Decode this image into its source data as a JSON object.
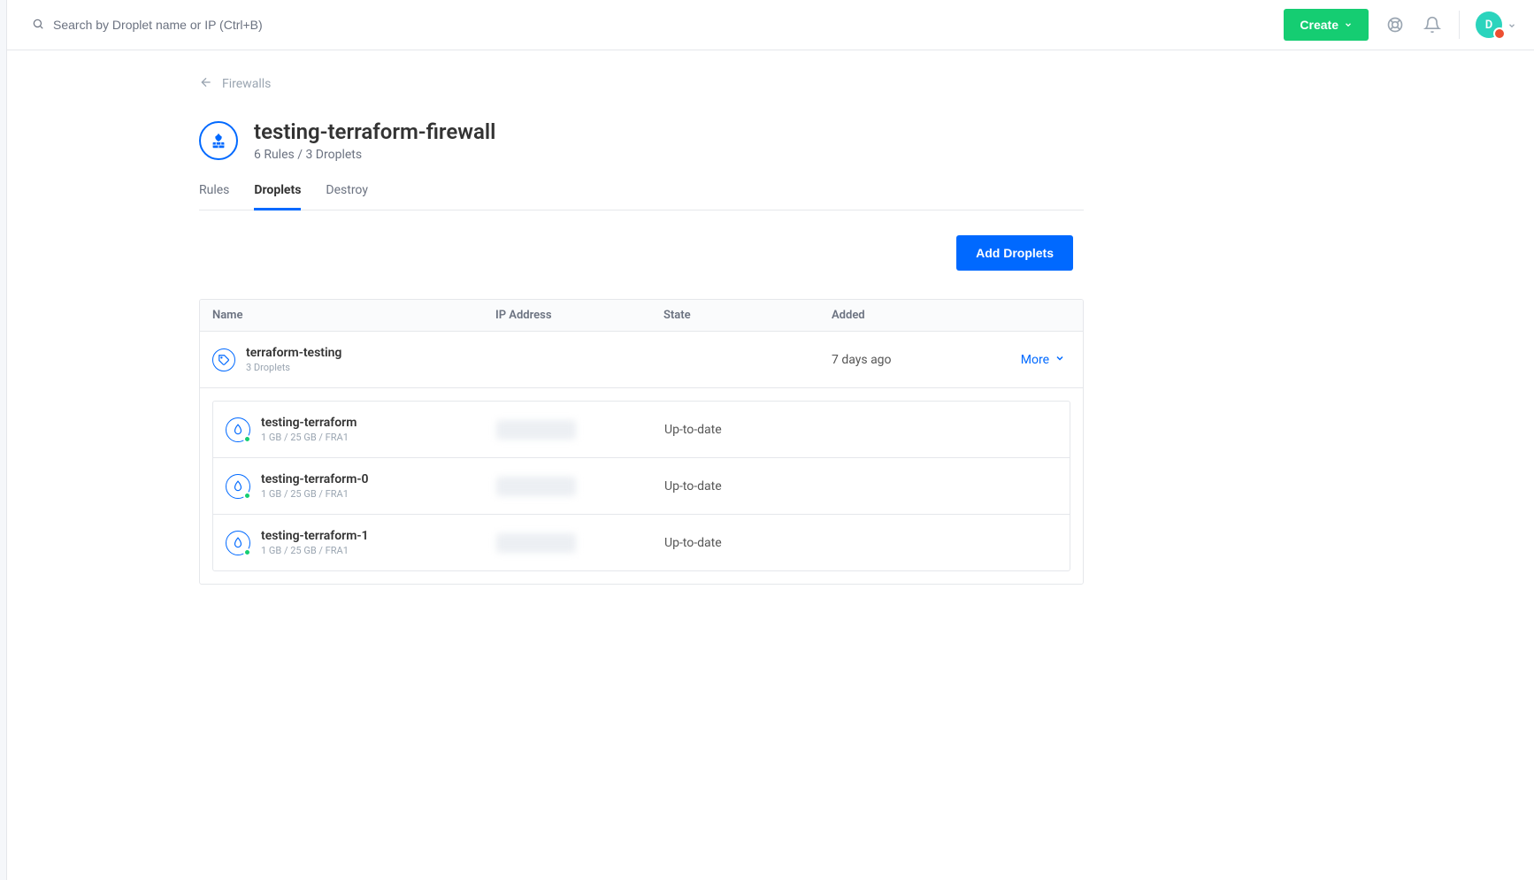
{
  "topbar": {
    "search_placeholder": "Search by Droplet name or IP (Ctrl+B)",
    "create_label": "Create",
    "avatar_initial": "D"
  },
  "breadcrumb": {
    "back_label": "Firewalls"
  },
  "page": {
    "title": "testing-terraform-firewall",
    "subtitle": "6 Rules / 3 Droplets"
  },
  "tabs": [
    {
      "label": "Rules",
      "active": false
    },
    {
      "label": "Droplets",
      "active": true
    },
    {
      "label": "Destroy",
      "active": false
    }
  ],
  "actions": {
    "add_droplets_label": "Add Droplets"
  },
  "table": {
    "columns": {
      "name": "Name",
      "ip": "IP Address",
      "state": "State",
      "added": "Added"
    },
    "group": {
      "name": "terraform-testing",
      "sub": "3 Droplets",
      "added": "7 days ago",
      "more_label": "More"
    },
    "droplets": [
      {
        "name": "testing-terraform",
        "spec": "1 GB / 25 GB / FRA1",
        "state": "Up-to-date"
      },
      {
        "name": "testing-terraform-0",
        "spec": "1 GB / 25 GB / FRA1",
        "state": "Up-to-date"
      },
      {
        "name": "testing-terraform-1",
        "spec": "1 GB / 25 GB / FRA1",
        "state": "Up-to-date"
      }
    ]
  }
}
